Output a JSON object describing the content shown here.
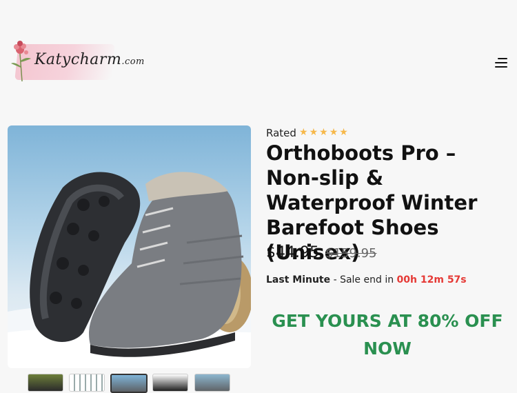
{
  "header": {
    "logo_text": "Katycharm",
    "logo_suffix": ".com",
    "menu_icon": "hamburger-menu-icon"
  },
  "product": {
    "rated_label": "Rated",
    "rating_stars": 5,
    "title": "Orthoboots Pro – Non-slip & Waterproof Winter Barefoot Shoes (Unisex)",
    "price": "$44.95",
    "old_price": "$159.95",
    "sale": {
      "last_minute": "Last Minute",
      "separator": " - Sale end in ",
      "timer": "00h 12m 57s"
    },
    "cta": "GET YOURS AT 80% OFF NOW"
  },
  "gallery": {
    "main_image": "grey winter barefoot boots on snow",
    "thumbnail_count": 5,
    "active_thumbnail": 3
  },
  "colors": {
    "accent_green": "#2a9050",
    "star_yellow": "#f6b84a",
    "timer_red": "#e53935",
    "logo_pink": "#f4c6d0"
  }
}
